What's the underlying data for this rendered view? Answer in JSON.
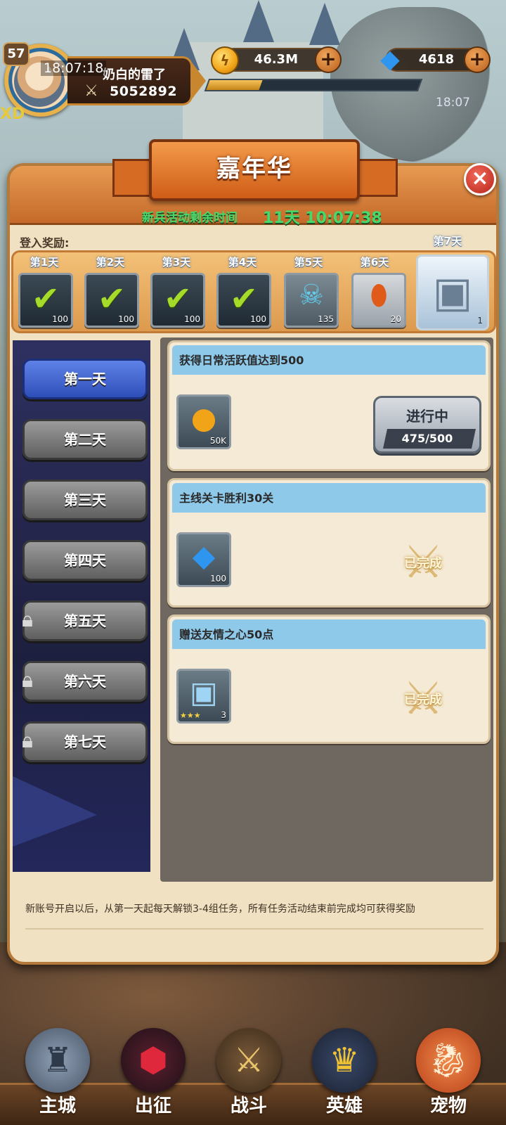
{
  "player": {
    "level": "57",
    "time_overlay": "18:07:18",
    "name": "奶白的雷了",
    "power": "5052892",
    "corner_text": "XD"
  },
  "resources": {
    "gold": "46.3M",
    "gems": "4618",
    "xp_progress": 0.25,
    "clock": "18:07"
  },
  "event": {
    "title": "嘉年华",
    "close_glyph": "×",
    "timer_label": "新兵活动剩余时间",
    "timer_value": "11天 10:07:38",
    "login_label": "登入奖励:",
    "login_days": [
      {
        "label": "第1天",
        "qty": "100",
        "claimed": true
      },
      {
        "label": "第2天",
        "qty": "100",
        "claimed": true
      },
      {
        "label": "第3天",
        "qty": "100",
        "claimed": true
      },
      {
        "label": "第4天",
        "qty": "100",
        "claimed": true
      },
      {
        "label": "第5天",
        "qty": "135",
        "claimed": false,
        "icon": "skull-helmet-icon"
      },
      {
        "label": "第6天",
        "qty": "20",
        "claimed": false,
        "icon": "rune-stone-icon"
      }
    ],
    "day7": {
      "label": "第7天",
      "qty": "1",
      "icon": "treasure-chest-icon"
    }
  },
  "tabs": [
    {
      "label": "第一天",
      "active": true,
      "locked": false
    },
    {
      "label": "第二天",
      "active": false,
      "locked": false
    },
    {
      "label": "第三天",
      "active": false,
      "locked": false
    },
    {
      "label": "第四天",
      "active": false,
      "locked": false
    },
    {
      "label": "第五天",
      "active": false,
      "locked": true
    },
    {
      "label": "第六天",
      "active": false,
      "locked": true
    },
    {
      "label": "第七天",
      "active": false,
      "locked": true
    }
  ],
  "tasks": [
    {
      "title": "获得日常活跃值达到500",
      "reward_qty": "50K",
      "reward_icon": "gold-coin-icon",
      "status": "进行中",
      "progress": "475/500"
    },
    {
      "title": "主线关卡胜利30关",
      "reward_qty": "100",
      "reward_icon": "blue-gem-icon",
      "status": "已完成"
    },
    {
      "title": "赠送友情之心50点",
      "reward_qty": "3",
      "reward_icon": "silver-chest-icon",
      "reward_stars": "★★★",
      "status": "已完成"
    }
  ],
  "footer_note": "新账号开启以后，从第一天起每天解锁3-4组任务，所有任务活动结束前完成均可获得奖励",
  "nav": [
    {
      "label": "主城",
      "icon": "castle-tower-icon"
    },
    {
      "label": "出征",
      "icon": "expedition-icon"
    },
    {
      "label": "战斗",
      "icon": "battle-shield-icon"
    },
    {
      "label": "英雄",
      "icon": "hero-crest-icon"
    },
    {
      "label": "宠物",
      "icon": "pet-dragon-icon"
    }
  ]
}
